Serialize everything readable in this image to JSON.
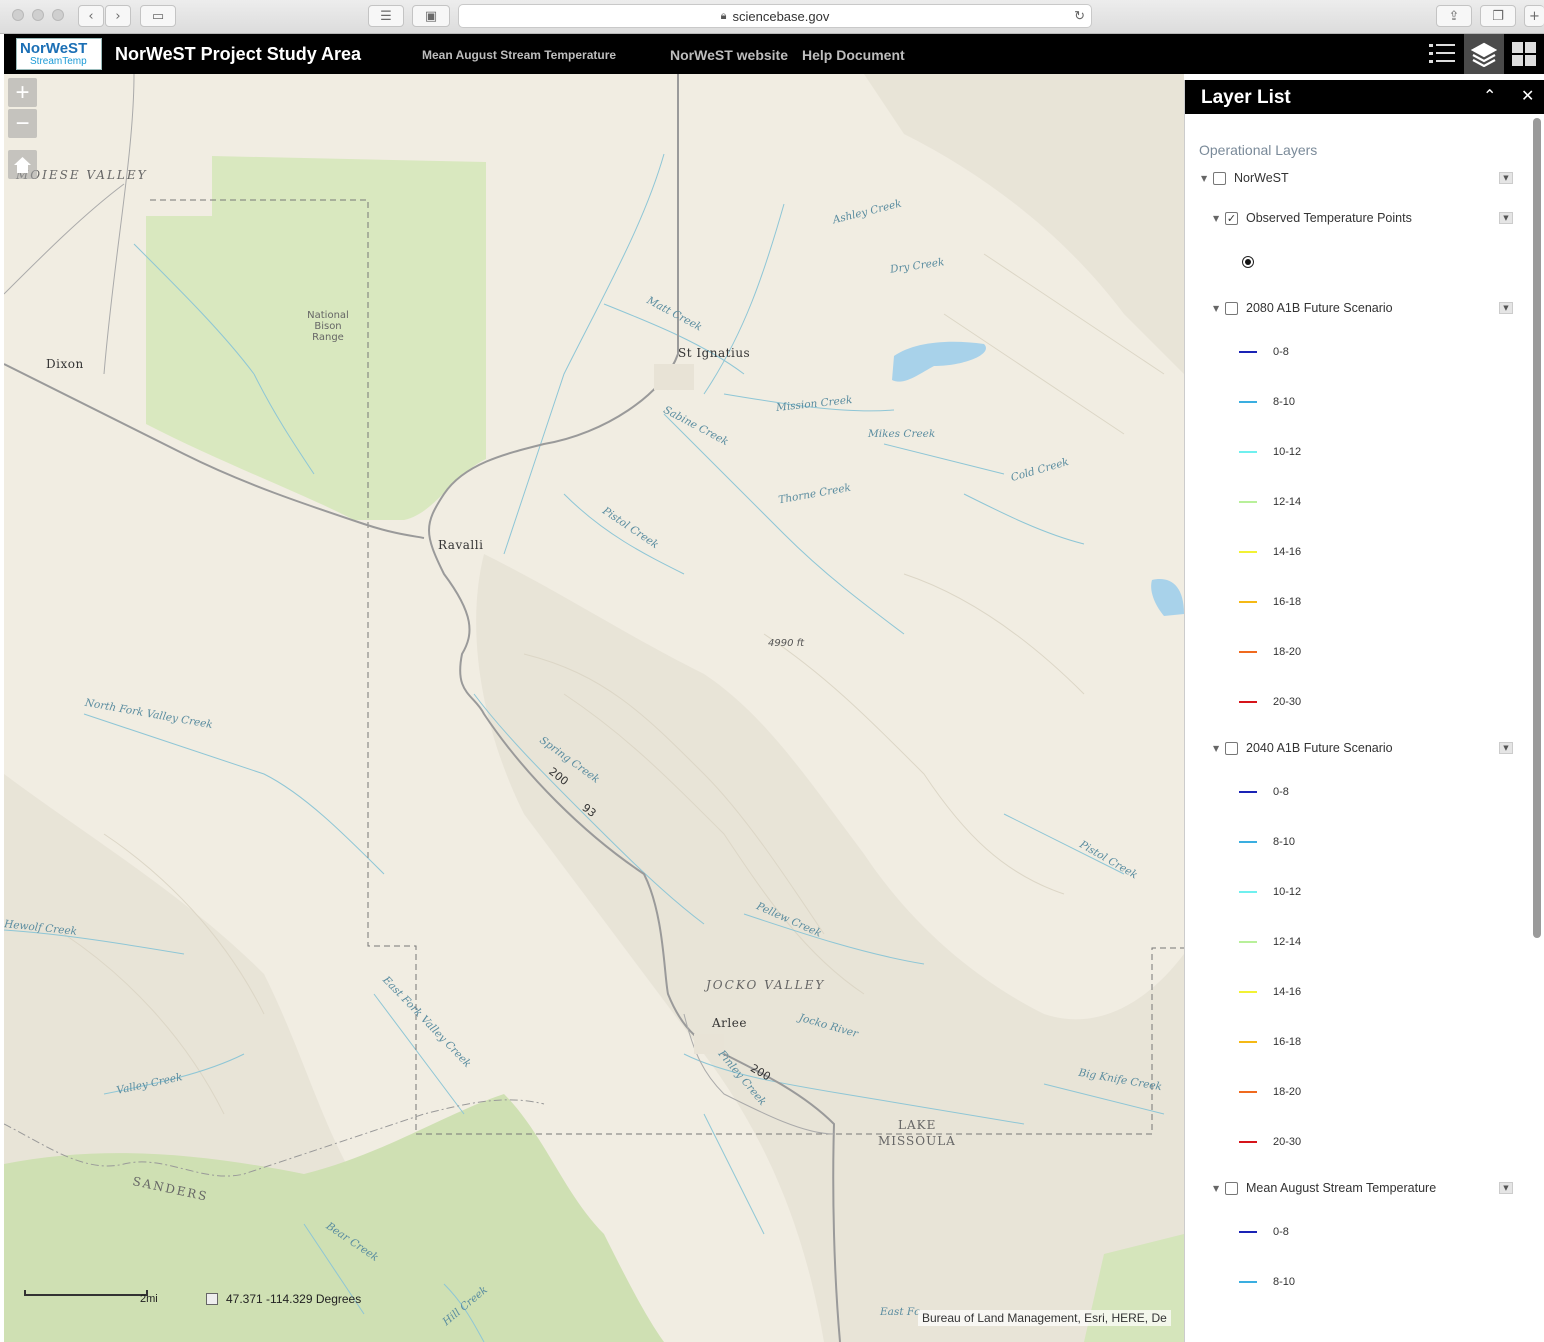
{
  "browser": {
    "url": "sciencebase.gov"
  },
  "header": {
    "logo_line1": "NorWeST",
    "logo_line2": "StreamTemp",
    "title": "NorWeST Project Study Area",
    "nav": {
      "mean_aug": "Mean August Stream Temperature",
      "website": "NorWeST website",
      "help": "Help Document"
    },
    "icons": [
      "list-icon",
      "layers-icon",
      "grid-icon"
    ]
  },
  "map": {
    "zoom_in": "+",
    "zoom_out": "−",
    "labels": {
      "moiese": "MOIESE VALLEY",
      "dixon": "Dixon",
      "bison": "National Bison Range",
      "ravalli": "Ravalli",
      "st_ignatius": "St Ignatius",
      "ashley": "Ashley Creek",
      "dry": "Dry Creek",
      "matt": "Matt Creek",
      "mission": "Mission Creek",
      "mikes": "Mikes Creek",
      "cold": "Cold Creek",
      "sabine": "Sabine Creek",
      "thorne": "Thorne Creek",
      "pistol1": "Pistol Creek",
      "elev": "4990 ft",
      "nfork": "North Fork Valley Creek",
      "spring": "Spring Creek",
      "hw200a": "200",
      "hw93": "93",
      "pistol2": "Pistol Creek",
      "pellew": "Pellew Creek",
      "hewolf": "Hewolf Creek",
      "jocko_valley": "JOCKO VALLEY",
      "arlee": "Arlee",
      "jocko_river": "Jocko River",
      "efork": "East Fork Valley Creek",
      "valley": "Valley Creek",
      "finley": "Finley Creek",
      "hw200b": "200",
      "bigknife": "Big Knife Creek",
      "lake": "LAKE",
      "missoula": "MISSOULA",
      "sanders": "SANDERS",
      "bear": "Bear Creek",
      "hill": "Hill Creek",
      "eastfc": "East Fc"
    },
    "scale": "2mi",
    "coords": "47.371  -114.329 Degrees",
    "attribution": "Bureau of Land Management, Esri, HERE, De"
  },
  "panel": {
    "title": "Layer List",
    "operational": "Operational Layers",
    "layers": {
      "norwest": "NorWeST",
      "observed": "Observed Temperature Points",
      "s2080": "2080 A1B Future Scenario",
      "s2040": "2040 A1B Future Scenario",
      "mean": "Mean August Stream Temperature"
    },
    "legend": [
      {
        "label": "0-8",
        "color": "#1a23b5"
      },
      {
        "label": "8-10",
        "color": "#3aaee0"
      },
      {
        "label": "10-12",
        "color": "#6ff0ef"
      },
      {
        "label": "12-14",
        "color": "#b8f09a"
      },
      {
        "label": "14-16",
        "color": "#f2f234"
      },
      {
        "label": "16-18",
        "color": "#f5b915"
      },
      {
        "label": "18-20",
        "color": "#f06a1e"
      },
      {
        "label": "20-30",
        "color": "#d6141a"
      }
    ]
  }
}
